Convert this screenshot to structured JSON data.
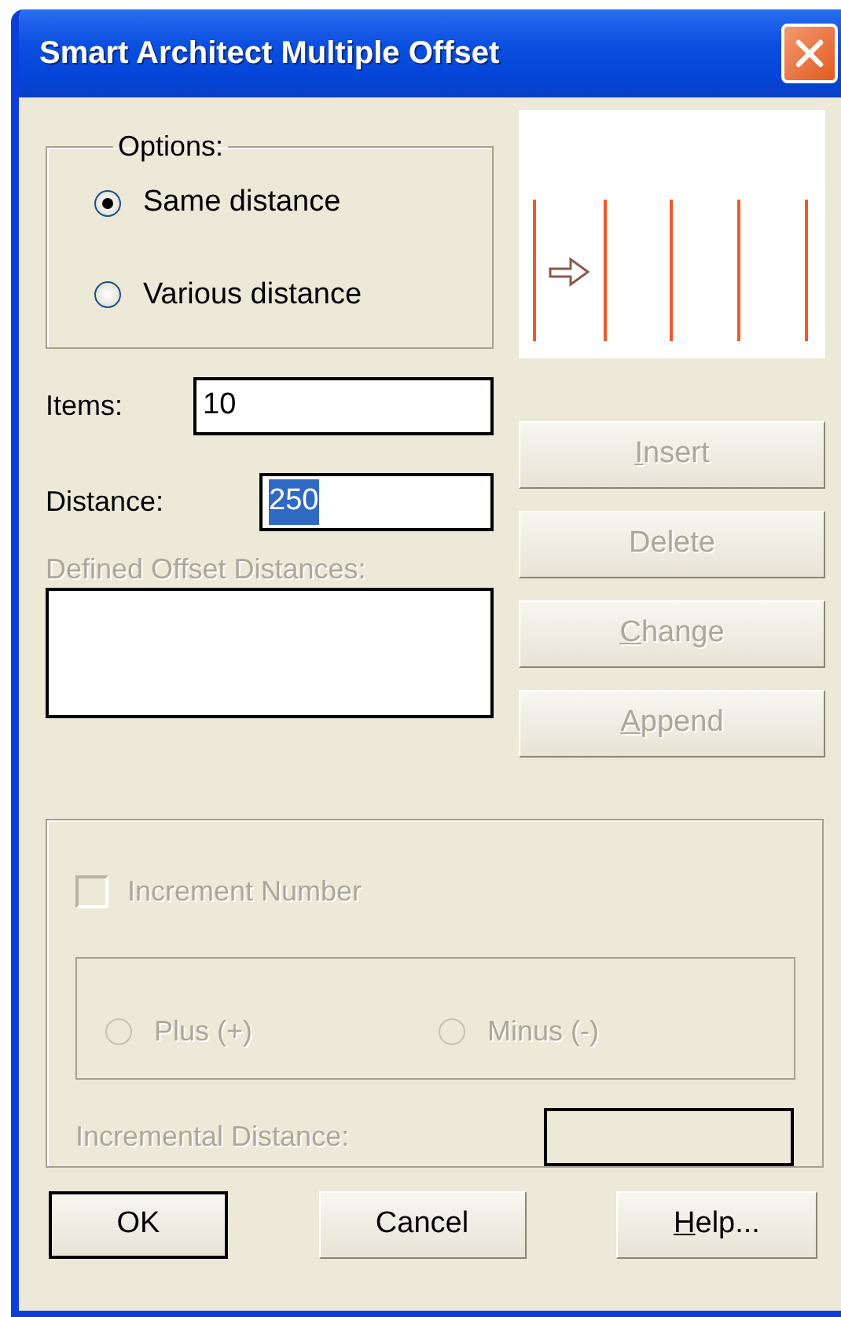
{
  "window": {
    "title": "Smart Architect Multiple Offset"
  },
  "options": {
    "legend": "Options:",
    "radios": [
      {
        "label": "Same distance",
        "selected": true
      },
      {
        "label": "Various distance",
        "selected": false
      }
    ]
  },
  "items": {
    "label": "Items:",
    "value": "10"
  },
  "distance": {
    "label": "Distance:",
    "value": "250",
    "text_selected": true
  },
  "defined_offsets": {
    "label": "Defined Offset Distances:",
    "disabled": true
  },
  "side_buttons": [
    {
      "label": "Insert",
      "disabled": true,
      "underline_first": true
    },
    {
      "label": "Delete",
      "disabled": true,
      "underline_first": false
    },
    {
      "label": "Change",
      "disabled": true,
      "underline_first": true
    },
    {
      "label": "Append",
      "disabled": true,
      "underline_first": true
    }
  ],
  "increment": {
    "checkbox": {
      "label": "Increment Number",
      "checked": false,
      "disabled": true
    },
    "direction": [
      {
        "label": "Plus (+)",
        "selected": false,
        "disabled": true
      },
      {
        "label": "Minus (-)",
        "selected": false,
        "disabled": true
      }
    ],
    "distance_label": "Incremental Distance:",
    "disabled": true
  },
  "buttons": [
    {
      "label": "OK",
      "default": true,
      "underline_first": false
    },
    {
      "label": "Cancel",
      "default": false,
      "underline_first": false
    },
    {
      "label": "Help...",
      "default": false,
      "underline_first": true
    }
  ]
}
